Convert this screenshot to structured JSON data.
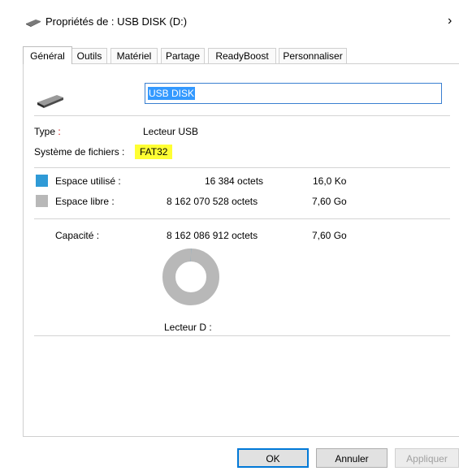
{
  "window": {
    "title": "Propriétés de : USB DISK (D:)",
    "close_glyph": "›"
  },
  "tabs": [
    {
      "label": "Général"
    },
    {
      "label": "Outils"
    },
    {
      "label": "Matériel"
    },
    {
      "label": "Partage"
    },
    {
      "label": "ReadyBoost"
    },
    {
      "label": "Personnaliser"
    }
  ],
  "active_tab": "Général",
  "general": {
    "volume_name": "USB DISK",
    "type_label": "Type",
    "type_value": "Lecteur USB",
    "filesystem_label": "Système de fichiers :",
    "filesystem_value": "FAT32",
    "used_label": "Espace utilisé :",
    "used_bytes": "16 384 octets",
    "used_short": "16,0 Ko",
    "free_label": "Espace libre :",
    "free_bytes": "8 162 070 528 octets",
    "free_short": "7,60 Go",
    "capacity_label": "Capacité :",
    "capacity_bytes": "8 162 086 912 octets",
    "capacity_short": "7,60 Go",
    "drive_label": "Lecteur D :",
    "used_fraction": 2e-06
  },
  "colors": {
    "used": "#2f9ad6",
    "free": "#b8b8b8",
    "highlight": "#ffff33"
  },
  "buttons": {
    "ok": "OK",
    "cancel": "Annuler",
    "apply": "Appliquer"
  }
}
